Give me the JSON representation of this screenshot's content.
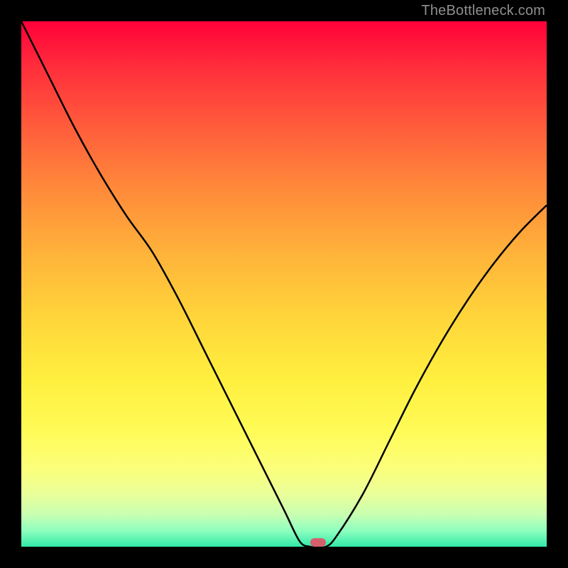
{
  "watermark": "TheBottleneck.com",
  "chart_data": {
    "type": "line",
    "title": "",
    "xlabel": "",
    "ylabel": "",
    "x": [
      0.0,
      0.05,
      0.1,
      0.15,
      0.2,
      0.25,
      0.3,
      0.35,
      0.4,
      0.45,
      0.5,
      0.53,
      0.55,
      0.56,
      0.58,
      0.6,
      0.65,
      0.7,
      0.75,
      0.8,
      0.85,
      0.9,
      0.95,
      1.0
    ],
    "values": [
      1.0,
      0.9,
      0.8,
      0.71,
      0.63,
      0.56,
      0.47,
      0.37,
      0.27,
      0.17,
      0.07,
      0.01,
      0.0,
      0.0,
      0.0,
      0.02,
      0.1,
      0.2,
      0.3,
      0.39,
      0.47,
      0.54,
      0.6,
      0.65
    ],
    "xlim": [
      0,
      1
    ],
    "ylim": [
      0,
      1
    ],
    "marker": {
      "x": 0.565,
      "y": 0.0
    },
    "annotations": []
  },
  "colors": {
    "curve": "#000000",
    "marker": "#d5606b",
    "background_stops": [
      "#ff003a",
      "#ffef3e",
      "#32e8a6"
    ]
  }
}
